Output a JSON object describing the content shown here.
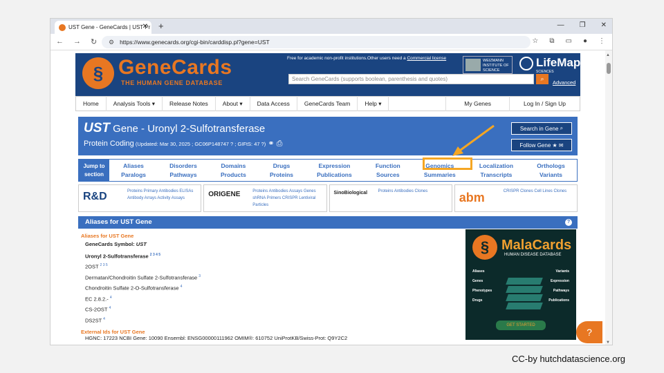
{
  "browser": {
    "tab_title": "UST Gene - GeneCards | UST Pr",
    "url": "https://www.genecards.org/cgi-bin/carddisp.pl?gene=UST"
  },
  "header": {
    "logo_title": "GeneCards",
    "logo_sub": "THE HUMAN GENE DATABASE",
    "free_text": "Free for academic non-profit institutions.Other users need a",
    "license_link": "Commercial license",
    "search_placeholder": "Search GeneCards (supports boolean, parenthesis and quotes)",
    "advanced": "Advanced",
    "weizmann": "WEIZMANN INSTITUTE OF SCIENCE",
    "lifemap": "LifeMap",
    "lifemap_sub": "SCIENCES"
  },
  "nav": {
    "items": [
      "Home",
      "Analysis Tools ▾",
      "Release Notes",
      "About ▾",
      "Data Access",
      "GeneCards Team",
      "Help ▾"
    ],
    "right": [
      "My Genes",
      "Log In  /  Sign Up"
    ]
  },
  "gene": {
    "symbol": "UST",
    "title": " Gene - Uronyl 2-Sulfotransferase",
    "type": "Protein Coding",
    "updated": " (Updated: Mar 30, 2025 ; GC06P148747 ? ; GIFtS: 47 ?)",
    "search_btn": "Search in Gene",
    "follow_btn": "Follow Gene"
  },
  "jump": {
    "label": "Jump to section",
    "cols": [
      {
        "a": "Aliases",
        "b": "Paralogs"
      },
      {
        "a": "Disorders",
        "b": "Pathways"
      },
      {
        "a": "Domains",
        "b": "Products"
      },
      {
        "a": "Drugs",
        "b": "Proteins"
      },
      {
        "a": "Expression",
        "b": "Publications"
      },
      {
        "a": "Function",
        "b": "Sources"
      },
      {
        "a": "Genomics",
        "b": "Summaries"
      },
      {
        "a": "Localization",
        "b": "Transcripts"
      },
      {
        "a": "Orthologs",
        "b": "Variants"
      }
    ]
  },
  "ads": [
    {
      "logo": "R&D",
      "links": "Proteins Primary Antibodies ELISAs Antibody Arrays Activity Assays"
    },
    {
      "logo": "ORIGENE",
      "links": "Proteins Antibodies Assays Genes shRNA Primers CRISPR Lentiviral Particles"
    },
    {
      "logo": "SinoBiological",
      "links": "Proteins Antibodies Clones"
    },
    {
      "logo": "abm",
      "links": "CRISPR Clones Cell Lines Clones"
    }
  ],
  "aliases": {
    "header": "Aliases for UST Gene",
    "section": "Aliases for UST Gene",
    "symbol_label": "GeneCards Symbol: ",
    "symbol": "UST",
    "lines": [
      {
        "text": "Uronyl 2-Sulfotransferase",
        "sup": "2 3 4 5",
        "bold": true
      },
      {
        "text": "2OST",
        "sup": "2 3 5"
      },
      {
        "text": "Dermatan/Chondroitin Sulfate 2-Sulfotransferase",
        "sup": "3"
      },
      {
        "text": "Chondroitin Sulfate 2-O-Sulfotransferase",
        "sup": "4"
      },
      {
        "text": "EC 2.8.2.-",
        "sup": "4"
      },
      {
        "text": "CS-2OST",
        "sup": "4"
      },
      {
        "text": "DS2ST",
        "sup": "4"
      }
    ],
    "external_header": "External Ids for UST Gene",
    "external_ids": "HGNC: 17223  NCBI Gene: 10090  Ensembl: ENSG00000111962  OMIM®: 610752  UniProtKB/Swiss-Prot: Q9Y2C2"
  },
  "malacards": {
    "title": "MalaCards",
    "sub": "HUMAN DISEASE DATABASE",
    "left": [
      "Aliases",
      "Genes",
      "Phenotypes",
      "Drugs"
    ],
    "right": [
      "Variants",
      "Expression",
      "Pathways",
      "Publications"
    ],
    "cta": "GET STARTED"
  },
  "credit": "CC-by hutchdatascience.org",
  "colors": {
    "brand_orange": "#e87722",
    "brand_blue": "#1a4480",
    "highlight": "#f5a623"
  }
}
